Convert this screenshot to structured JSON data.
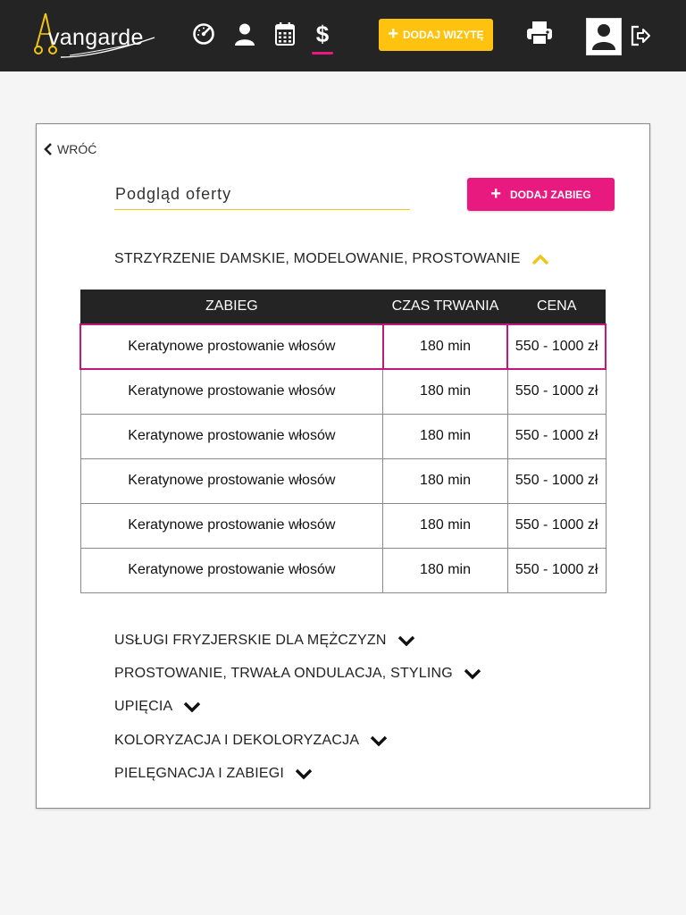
{
  "brand": {
    "logo_text": "vangarde",
    "logo_letter": "A"
  },
  "nav": {
    "items": [
      {
        "name": "dashboard",
        "icon": "speedometer-icon"
      },
      {
        "name": "clients",
        "icon": "user-icon"
      },
      {
        "name": "calendar",
        "icon": "calendar-icon"
      },
      {
        "name": "pricing",
        "icon": "dollar-icon",
        "active": true
      }
    ],
    "add_visit_label": "DODAJ WIZYTĘ",
    "accent": "#e8197f",
    "yellow": "#ffc20e"
  },
  "card": {
    "back_label": "WRÓĆ",
    "title_value": "Podgląd oferty",
    "add_service_label": "DODAJ ZABIEG",
    "open_category": "STRZYRZENIE DAMSKIE, MODELOWANIE, PROSTOWANIE",
    "table": {
      "headers": [
        "ZABIEG",
        "CZAS TRWANIA",
        "CENA"
      ],
      "rows": [
        [
          "Keratynowe prostowanie włosów",
          "180 min",
          "550 - 1000 zł"
        ],
        [
          "Keratynowe prostowanie włosów",
          "180 min",
          "550 - 1000 zł"
        ],
        [
          "Keratynowe prostowanie włosów",
          "180 min",
          "550 - 1000 zł"
        ],
        [
          "Keratynowe prostowanie włosów",
          "180 min",
          "550 - 1000 zł"
        ],
        [
          "Keratynowe prostowanie włosów",
          "180 min",
          "550 - 1000 zł"
        ],
        [
          "Keratynowe prostowanie włosów",
          "180 min",
          "550 - 1000 zł"
        ]
      ]
    },
    "collapsed_categories": [
      "USŁUGI FRYZJERSKIE DLA MĘŻCZYZN",
      "PROSTOWANIE, TRWAŁA ONDULACJA, STYLING",
      "UPIĘCIA",
      "KOLORYZACJA I DEKOLORYZACJA",
      "PIELĘGNACJA I ZABIEGI"
    ]
  }
}
